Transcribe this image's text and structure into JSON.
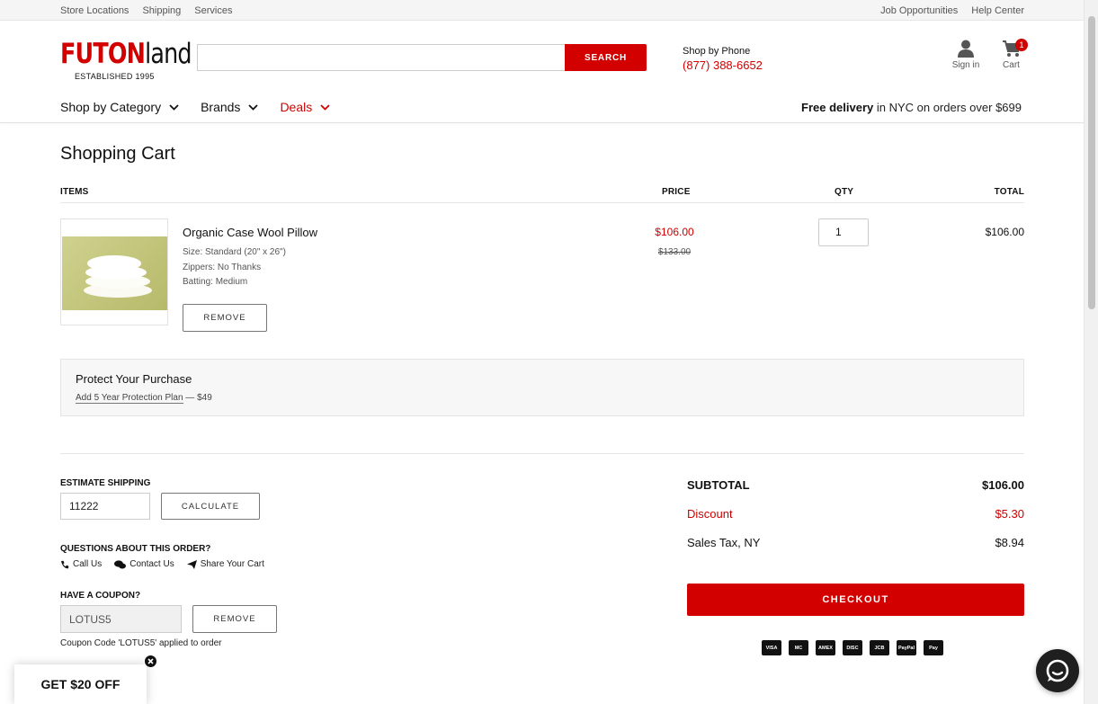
{
  "utility": {
    "left": [
      "Store Locations",
      "Shipping",
      "Services"
    ],
    "right": [
      "Job Opportunities",
      "Help Center"
    ]
  },
  "logo": {
    "word_red": "FUTON",
    "word_dark": "land",
    "tagline": "ESTABLISHED 1995"
  },
  "search": {
    "placeholder": "",
    "button": "SEARCH"
  },
  "phone": {
    "label": "Shop by Phone",
    "number": "(877) 388-6652"
  },
  "account": {
    "signin": "Sign in",
    "cart": "Cart",
    "cart_count": "1"
  },
  "nav": {
    "category": "Shop by Category",
    "brands": "Brands",
    "deals": "Deals"
  },
  "delivery": {
    "bold": "Free delivery",
    "rest": " in NYC on orders over $699"
  },
  "cart": {
    "title": "Shopping Cart",
    "headers": {
      "items": "ITEMS",
      "price": "PRICE",
      "qty": "QTY",
      "total": "TOTAL"
    },
    "item": {
      "name": "Organic Case Wool Pillow",
      "specs": [
        "Size:  Standard (20\" x 26\")",
        "Zippers:  No Thanks",
        "Batting:  Medium"
      ],
      "remove": "REMOVE",
      "price": "$106.00",
      "old_price": "$133.00",
      "qty": "1",
      "total": "$106.00"
    }
  },
  "protect": {
    "heading": "Protect Your Purchase",
    "link": "Add 5 Year Protection Plan",
    "price": " — $49"
  },
  "shipping": {
    "label": "ESTIMATE SHIPPING",
    "zip": "11222",
    "button": "CALCULATE"
  },
  "questions": {
    "label": "QUESTIONS ABOUT THIS ORDER?",
    "call": "Call Us",
    "contact": "Contact Us",
    "share": "Share Your Cart"
  },
  "coupon": {
    "label": "HAVE A COUPON?",
    "code": "LOTUS5",
    "button": "REMOVE",
    "note": "Coupon Code 'LOTUS5' applied to order"
  },
  "summary": {
    "subtotal_label": "SUBTOTAL",
    "subtotal": "$106.00",
    "discount_label": "Discount",
    "discount": "$5.30",
    "tax_label": "Sales Tax, NY",
    "tax": "$8.94",
    "checkout": "CHECKOUT"
  },
  "payments": [
    "VISA",
    "MC",
    "AMEX",
    "DISC",
    "JCB",
    "PayPal",
    "Pay"
  ],
  "promo": {
    "label": "GET $20 OFF"
  },
  "colors": {
    "brand_red": "#d30000"
  }
}
